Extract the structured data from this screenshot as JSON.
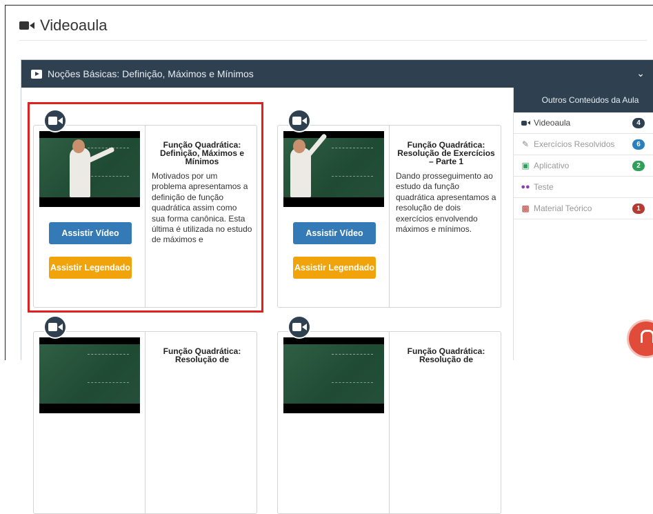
{
  "page": {
    "title": "Videoaula"
  },
  "panel": {
    "title": "Noções Básicas: Definição, Máximos e Mínimos"
  },
  "cards": [
    {
      "title": "Função Quadrática: Definição, Máximos e Mínimos",
      "description": "Motivados por um problema apresentamos a definição de função quadrática assim como sua forma canônica. Esta última é utilizada no estudo de máximos e",
      "watch_label": "Assistir Vídeo",
      "subtitled_label": "Assistir Legendado"
    },
    {
      "title": "Função Quadrática: Resolução de Exercícios – Parte 1",
      "description": "Dando prosseguimento ao estudo da função quadrática apresentamos a resolução de dois exercícios envolvendo máximos e mínimos.",
      "watch_label": "Assistir Vídeo",
      "subtitled_label": "Assistir Legendado"
    },
    {
      "title": "Função Quadrática: Resolução de"
    },
    {
      "title": "Função Quadrática: Resolução de"
    }
  ],
  "sidebar": {
    "header": "Outros Conteúdos da Aula",
    "items": [
      {
        "label": "Videoaula",
        "count": "4",
        "color": "#2f4050"
      },
      {
        "label": "Exercícios Resolvidos",
        "count": "6",
        "color": "#2a7fbf"
      },
      {
        "label": "Aplicativo",
        "count": "2",
        "color": "#2ea05a"
      },
      {
        "label": "Teste",
        "count": "",
        "color": "#8a3fb0"
      },
      {
        "label": "Material Teórico",
        "count": "1",
        "color": "#b63a32"
      }
    ]
  },
  "colors": {
    "highlight": "#e0201d",
    "primary": "#337ab7",
    "warning": "#f0a30a",
    "dark": "#2f4050"
  }
}
